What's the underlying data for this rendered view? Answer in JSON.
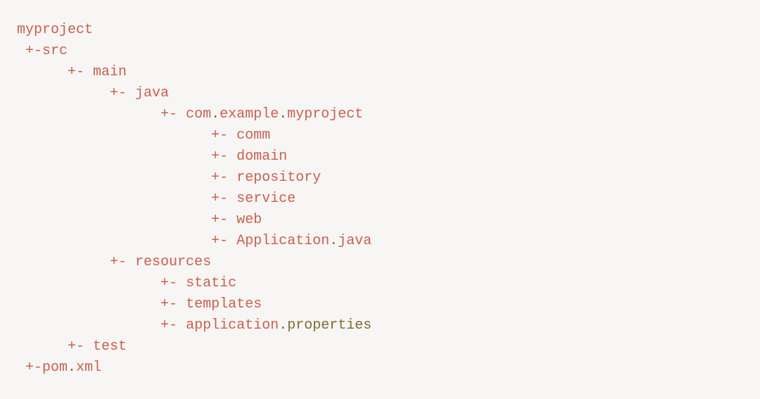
{
  "tree": {
    "root": "myproject",
    "src_prefix": "+-",
    "src": "src",
    "branch": "+- ",
    "main": "main",
    "java": "java",
    "package_prefix": "com",
    "package_dot1": ".",
    "package_mid": "example",
    "package_dot2": ".",
    "package_tail": "myproject",
    "comm": "comm",
    "domain": "domain",
    "repository": "repository",
    "service": "service",
    "web": "web",
    "app_java_base": "Application",
    "app_java_dot": ".",
    "app_java_ext": "java",
    "resources": "resources",
    "static": "static",
    "templates": "templates",
    "app_props_base": "application",
    "app_props_dot": ".",
    "app_props_ext": "properties",
    "test": "test",
    "pom_prefix": "+-",
    "pom_base": "pom",
    "pom_dot": ".",
    "pom_ext": "xml",
    "indent1": " ",
    "indent2": "      ",
    "indent3": "           ",
    "indent4": "                 ",
    "indent5": "                       ",
    "indent4b": "           ",
    "indent5b": "                 "
  }
}
